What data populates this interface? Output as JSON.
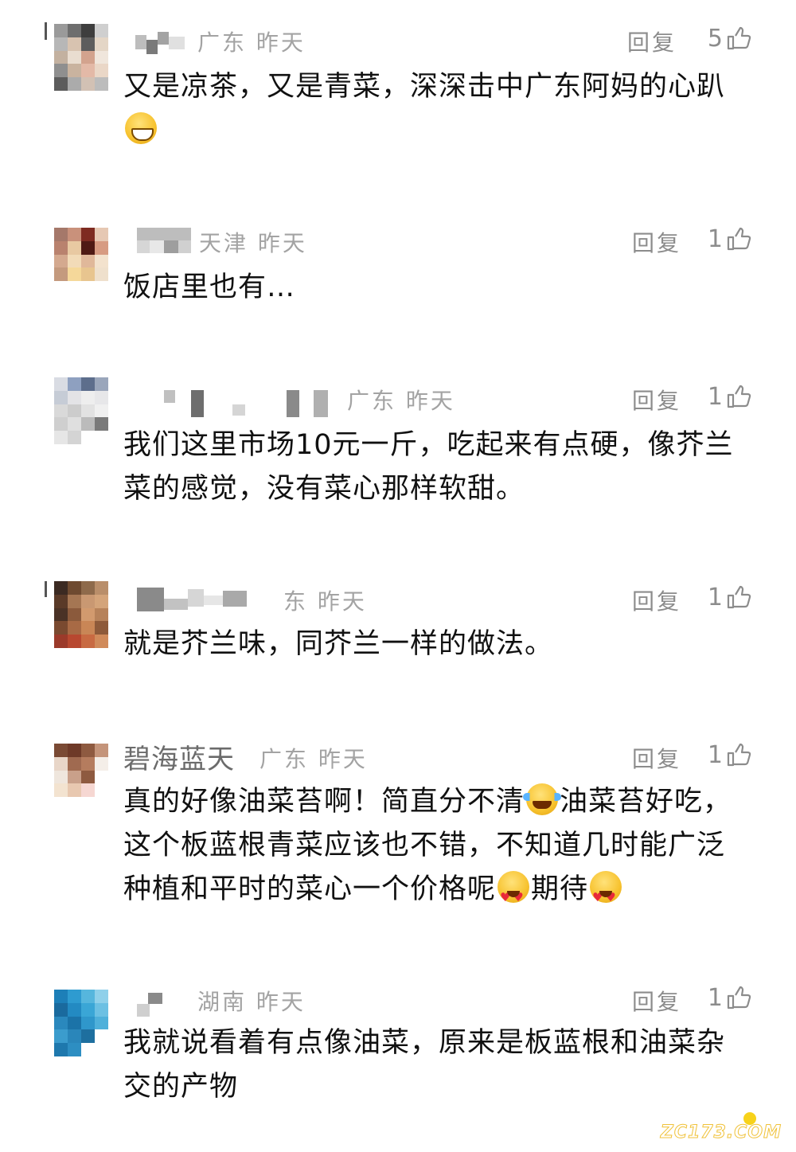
{
  "reply_label": "回复",
  "comments": [
    {
      "nickname": "",
      "location": "广东",
      "time": "昨天",
      "likes": "5",
      "text": "又是凉茶，又是青菜，深深击中广东阿妈的心趴"
    },
    {
      "nickname": "",
      "location": "天津",
      "time": "昨天",
      "likes": "1",
      "text": "饭店里也有…"
    },
    {
      "nickname": "",
      "location": "广东",
      "time": "昨天",
      "likes": "1",
      "text": "我们这里市场10元一斤，吃起来有点硬，像芥兰菜的感觉，没有菜心那样软甜。"
    },
    {
      "nickname": "",
      "location": "东",
      "time": "昨天",
      "likes": "1",
      "text": "就是芥兰味，同芥兰一样的做法。"
    },
    {
      "nickname": "碧海蓝天",
      "location": "广东",
      "time": "昨天",
      "likes": "1",
      "text_parts": [
        "真的好像油菜苔啊！简直分不清",
        "油菜苔好吃，这个板蓝根青菜应该也不错，不知道几时能广泛种植和平时的菜心一个价格呢",
        "期待"
      ]
    },
    {
      "nickname": "",
      "location": "湖南",
      "time": "昨天",
      "likes": "1",
      "text": "我就说看着有点像油菜，原来是板蓝根和油菜杂交的产物"
    }
  ],
  "emoji": {
    "c1": "grinning-face-emoji",
    "c5a": "tears-of-joy-emoji",
    "c5b": "heart-eyes-emoji"
  },
  "watermark": "ZC173.COM"
}
